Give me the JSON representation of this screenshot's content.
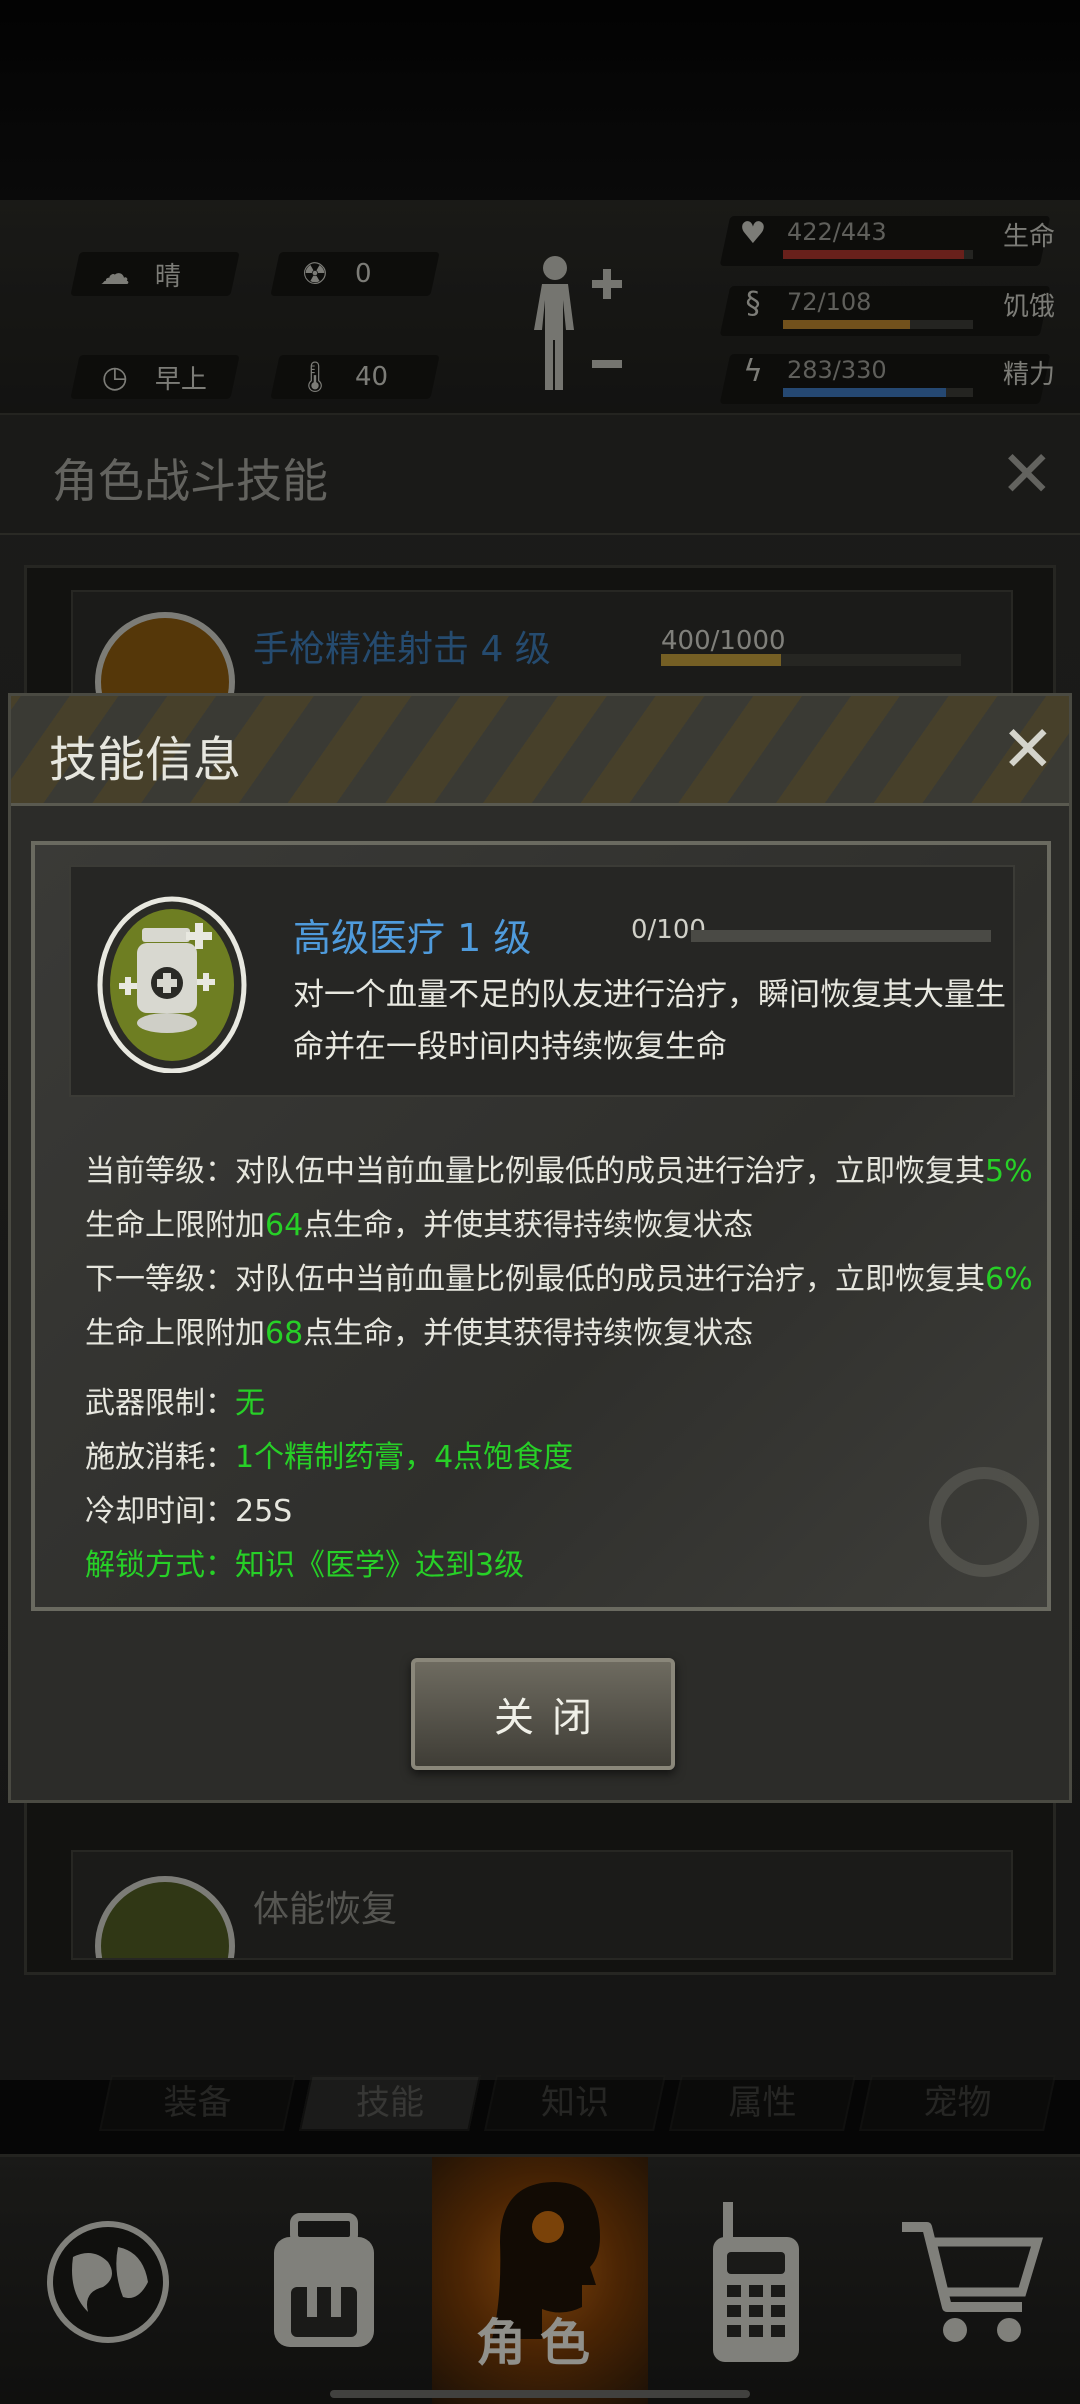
{
  "hud": {
    "weather": "晴",
    "radiation": "0",
    "time_of_day": "早上",
    "temperature": "40",
    "stats": [
      {
        "value": "422/443",
        "name": "生命",
        "fraction": 0.953,
        "color": "#a8352c"
      },
      {
        "value": "72/108",
        "name": "饥饿",
        "fraction": 0.667,
        "color": "#b8842e"
      },
      {
        "value": "283/330",
        "name": "精力",
        "fraction": 0.858,
        "color": "#3d74b8"
      }
    ]
  },
  "skills_panel": {
    "title": "角色战斗技能",
    "items": [
      {
        "name": "手枪精准射击 4 级",
        "progress": "400/1000",
        "fraction": 0.4
      },
      {
        "name": "体能恢复"
      }
    ]
  },
  "tabs": [
    {
      "label": "装备"
    },
    {
      "label": "技能",
      "active": true
    },
    {
      "label": "知识"
    },
    {
      "label": "属性"
    },
    {
      "label": "宠物"
    }
  ],
  "bottom_nav": {
    "active_label": "角色"
  },
  "modal": {
    "title": "技能信息",
    "skill": {
      "name": "高级医疗 1 级",
      "progress": "0/100",
      "fraction": 0.0,
      "desc": "对一个血量不足的队友进行治疗，瞬间恢复其大量生命并在一段时间内持续恢复生命"
    },
    "current": {
      "prefix": "当前等级：对队伍中当前血量比例最低的成员进行治疗，立即恢复其",
      "pct": "5%",
      "line2_a": "生命上限附加",
      "hp": "64",
      "line2_b": "点生命，并使其获得持续恢复状态"
    },
    "next": {
      "prefix": "下一等级：对队伍中当前血量比例最低的成员进行治疗，立即恢复其",
      "pct": "6%",
      "line2_a": "生命上限附加",
      "hp": "68",
      "line2_b": "点生命，并使其获得持续恢复状态"
    },
    "weapon": {
      "label": "武器限制：",
      "value": "无"
    },
    "cost": {
      "label": "施放消耗：",
      "value": "1个精制药膏，4点饱食度"
    },
    "cooldown": {
      "label": "冷却时间：",
      "value": "25S"
    },
    "unlock": "解锁方式：知识《医学》达到3级",
    "close_button": "关闭"
  }
}
